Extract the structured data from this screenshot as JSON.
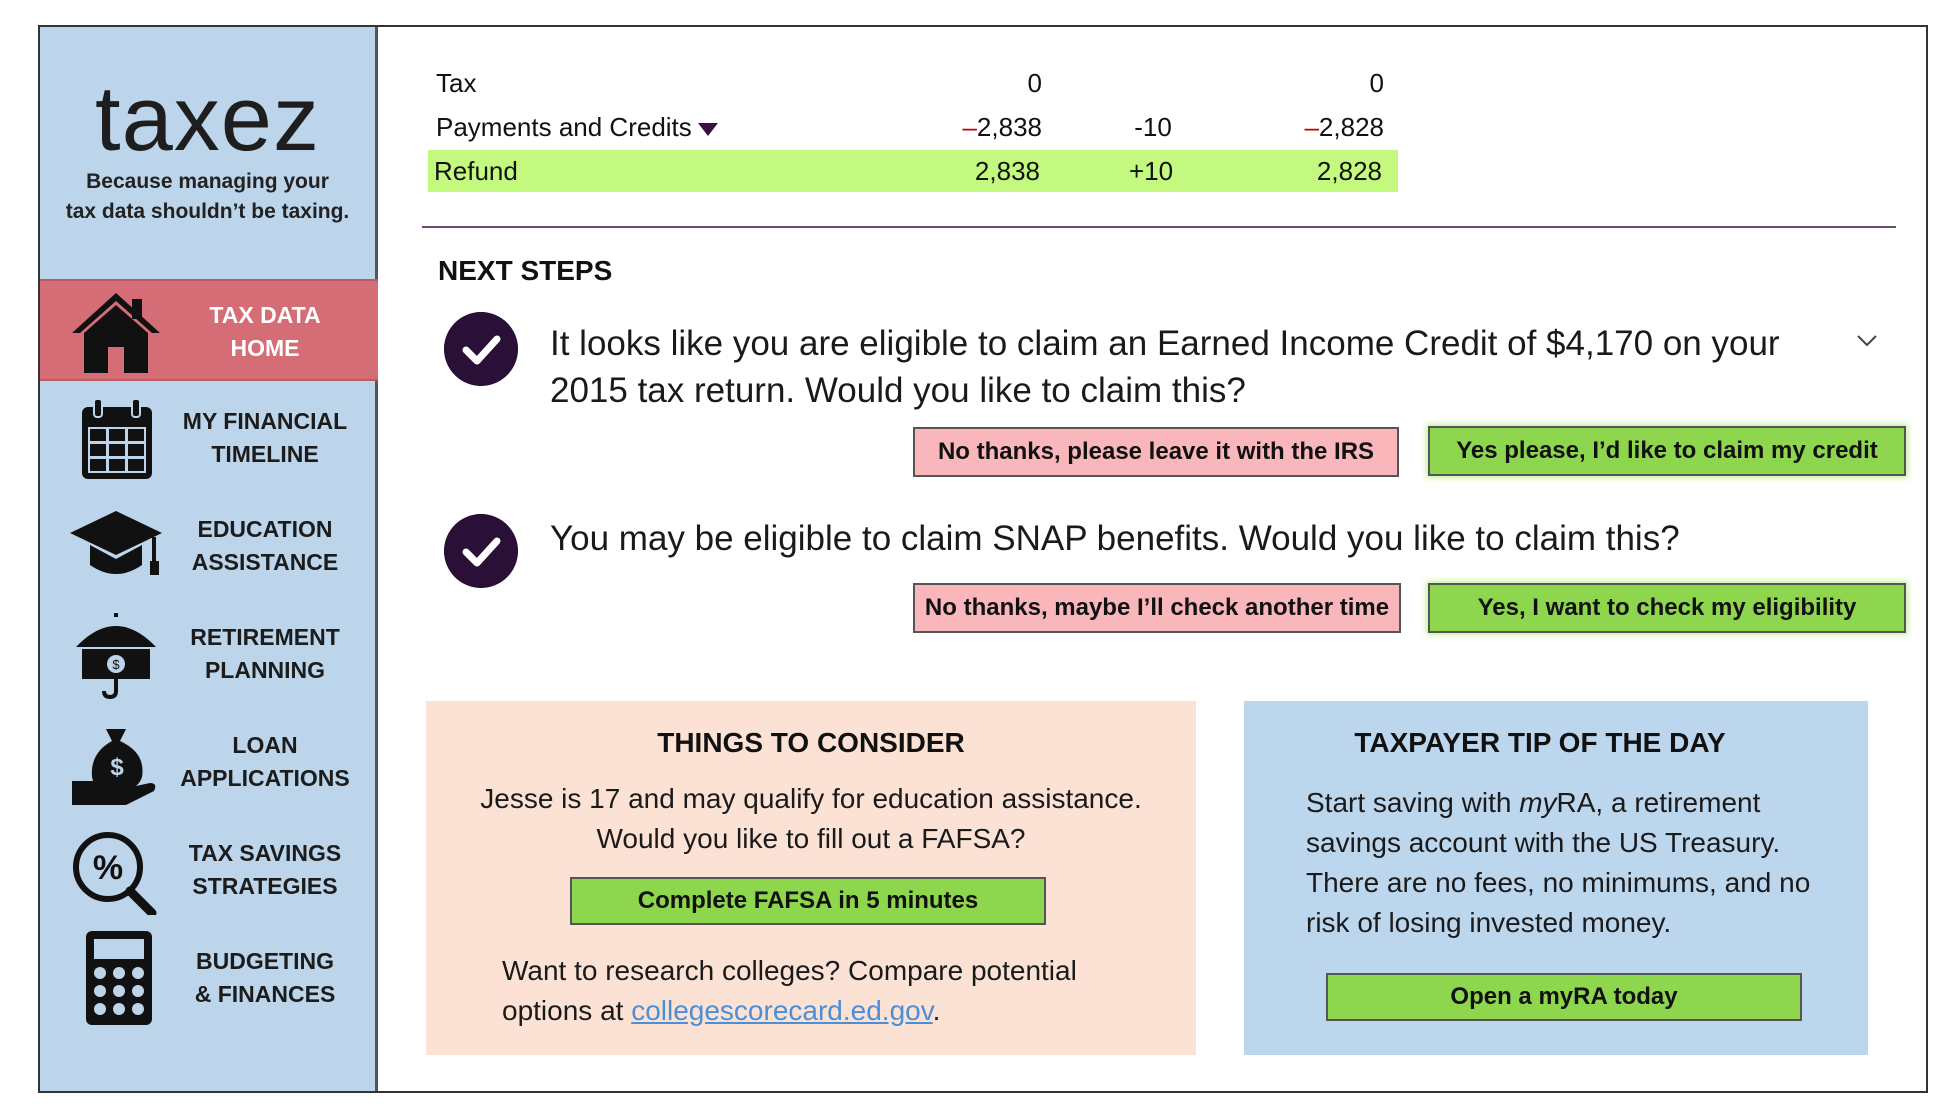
{
  "app": {
    "logo": "taxez",
    "tagline": "Because managing your\ntax data shouldn’t be taxing."
  },
  "sidebar": {
    "items": [
      {
        "label": "TAX DATA\nHOME",
        "icon": "house-icon",
        "active": true
      },
      {
        "label": "MY FINANCIAL\nTIMELINE",
        "icon": "calendar-icon"
      },
      {
        "label": "EDUCATION\nASSISTANCE",
        "icon": "graduation-cap-icon"
      },
      {
        "label": "RETIREMENT\nPLANNING",
        "icon": "umbrella-money-icon"
      },
      {
        "label": "LOAN\nAPPLICATIONS",
        "icon": "money-bag-hand-icon"
      },
      {
        "label": "TAX SAVINGS\nSTRATEGIES",
        "icon": "percent-magnifier-icon"
      },
      {
        "label": "BUDGETING\n& FINANCES",
        "icon": "calculator-icon"
      }
    ]
  },
  "summary": {
    "rows": [
      {
        "label": "Tax",
        "col1": "0",
        "col2": "",
        "col3": "0"
      },
      {
        "label": "Payments and Credits",
        "col1_sign": "–",
        "col1": "2,838",
        "col2": "-10",
        "col3_sign": "–",
        "col3": "2,828"
      },
      {
        "label": "Refund",
        "col1": "2,838",
        "col2": "+10",
        "col3": "2,828"
      }
    ],
    "refund_highlight": "#c4f97f"
  },
  "next_steps": {
    "heading": "NEXT STEPS",
    "items": [
      {
        "question": "It looks like you are eligible to claim an Earned Income Credit of $4,170 on your 2015 tax return. Would you like to claim this?",
        "no_label": "No thanks, please leave it with the IRS",
        "yes_label": "Yes please, I’d like to claim my  credit"
      },
      {
        "question": "You may be eligible to claim SNAP benefits. Would you like to claim this?",
        "no_label": "No thanks, maybe I’ll check another time",
        "yes_label": "Yes, I want to check my eligibility"
      }
    ]
  },
  "consider": {
    "title": "THINGS TO CONSIDER",
    "text": "Jesse is 17 and may qualify for education assistance. Would you like to  fill out a FAFSA?",
    "button": "Complete FAFSA in 5 minutes",
    "research_text": "Want to research colleges? Compare potential options at ",
    "link_text": "collegescorecard.ed.gov",
    "link_suffix": "."
  },
  "tip": {
    "title": "TAXPAYER TIP OF THE DAY",
    "text_before": "Start saving with ",
    "text_italic": "my",
    "text_after": "RA, a retirement savings account with the US Treasury. There are no fees, no minimums, and no risk of losing invested money.",
    "button": "Open a myRA today"
  },
  "colors": {
    "sidebar_bg": "#bcd5ea",
    "active_nav": "#d46d76",
    "check_bg": "#2a1036",
    "yes_button": "#8fd64f",
    "no_button": "#f9b7bb",
    "consider_bg": "#fbe2d5",
    "tip_bg": "#bcd6ee"
  }
}
